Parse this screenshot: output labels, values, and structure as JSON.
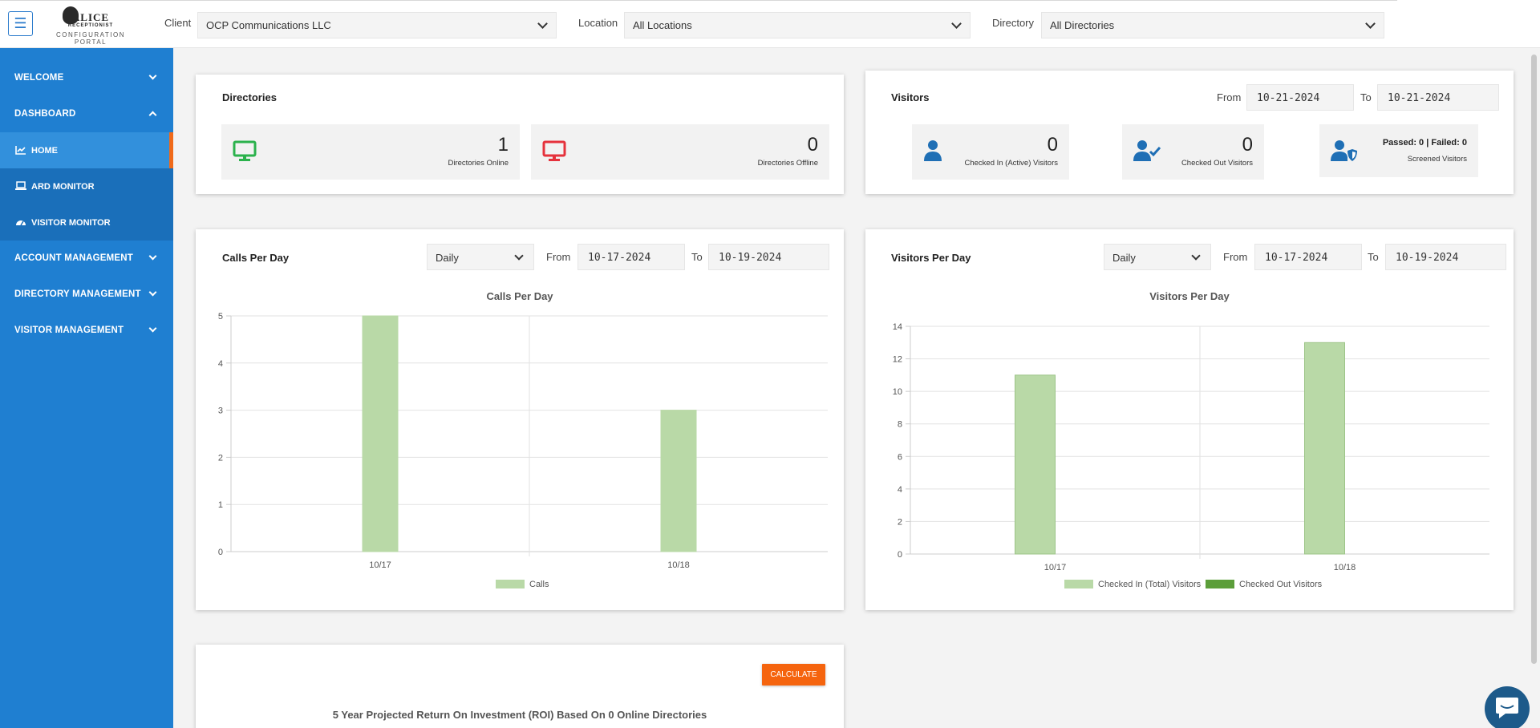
{
  "header": {
    "menu_icon": "hamburger-icon",
    "logo_text": "ALICE",
    "logo_text2": "RECEPTIONIST",
    "logo_sub": "CONFIGURATION PORTAL",
    "client_label": "Client",
    "client_value": "OCP Communications LLC",
    "location_label": "Location",
    "location_value": "All Locations",
    "directory_label": "Directory",
    "directory_value": "All Directories"
  },
  "sidebar": {
    "welcome": "WELCOME",
    "dashboard": "DASHBOARD",
    "home": "HOME",
    "ard_monitor": "ARD MONITOR",
    "visitor_monitor": "VISITOR MONITOR",
    "account_management": "ACCOUNT MANAGEMENT",
    "directory_management": "DIRECTORY MANAGEMENT",
    "visitor_management": "VISITOR MANAGEMENT"
  },
  "directories": {
    "title": "Directories",
    "online_count": "1",
    "online_label": "Directories Online",
    "offline_count": "0",
    "offline_label": "Directories Offline"
  },
  "visitors": {
    "title": "Visitors",
    "from_label": "From",
    "from_value": "10-21-2024",
    "to_label": "To",
    "to_value": "10-21-2024",
    "checked_in_count": "0",
    "checked_in_label": "Checked In (Active) Visitors",
    "checked_out_count": "0",
    "checked_out_label": "Checked Out Visitors",
    "screened_summary": "Passed: 0 | Failed: 0",
    "screened_label": "Screened Visitors"
  },
  "calls_panel": {
    "title": "Calls Per Day",
    "period": "Daily",
    "from_label": "From",
    "from_value": "10-17-2024",
    "to_label": "To",
    "to_value": "10-19-2024"
  },
  "visitors_panel": {
    "title": "Visitors Per Day",
    "period": "Daily",
    "from_label": "From",
    "from_value": "10-17-2024",
    "to_label": "To",
    "to_value": "10-19-2024"
  },
  "roi": {
    "button": "CALCULATE",
    "title": "5 Year Projected Return On Investment (ROI) Based On 0 Online Directories"
  },
  "colors": {
    "sidebar": "#1f7fd1",
    "accent": "#f5640e",
    "online": "#2bb24c",
    "offline": "#e5323c",
    "bar_light": "#b9d9a7",
    "bar_dark": "#5c9e3a",
    "icon_blue": "#1f6fb5"
  },
  "chart_data": [
    {
      "type": "bar",
      "title": "Calls Per Day",
      "categories": [
        "10/17",
        "10/18"
      ],
      "series": [
        {
          "name": "Calls",
          "values": [
            5,
            3
          ]
        }
      ],
      "ylim": [
        0,
        5
      ],
      "yticks": [
        0,
        1,
        2,
        3,
        4,
        5
      ],
      "grid": true,
      "legend": "bottom"
    },
    {
      "type": "bar",
      "title": "Visitors Per Day",
      "categories": [
        "10/17",
        "10/18"
      ],
      "series": [
        {
          "name": "Checked In (Total) Visitors",
          "values": [
            11,
            13
          ]
        },
        {
          "name": "Checked Out Visitors",
          "values": [
            0,
            0
          ]
        }
      ],
      "ylim": [
        0,
        14
      ],
      "yticks": [
        0,
        2,
        4,
        6,
        8,
        10,
        12,
        14
      ],
      "grid": true,
      "legend": "bottom"
    }
  ]
}
